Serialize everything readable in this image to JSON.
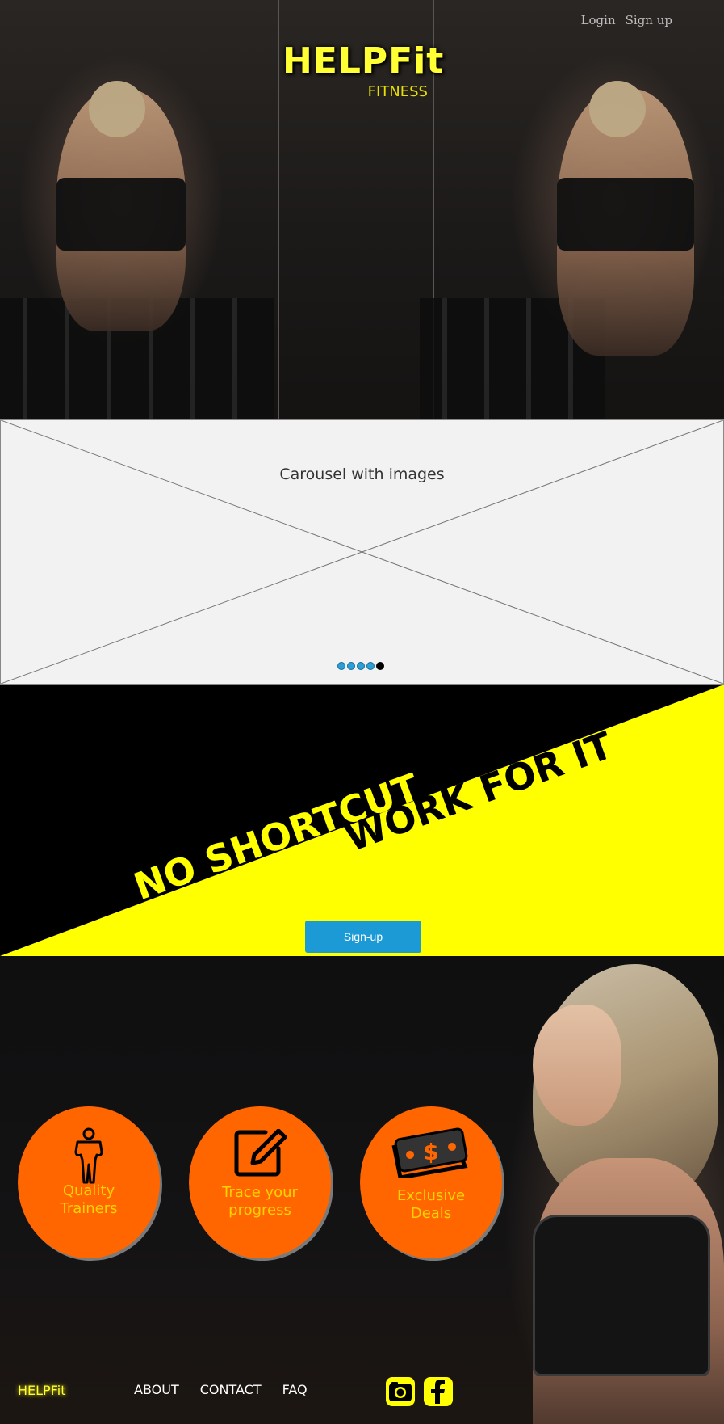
{
  "header": {
    "brand_name": "HELPFit",
    "brand_tagline": "FITNESS",
    "login_label": "Login",
    "signup_label": "Sign up"
  },
  "carousel": {
    "label": "Carousel with images",
    "dot_count": 5,
    "active_index": 4
  },
  "slogan": {
    "line1": "NO SHORTCUT",
    "line2": "WORK FOR IT",
    "signup_button": "Sign-up",
    "colors": {
      "dark": "#000000",
      "accent": "#ffff00",
      "button": "#1b9ad6"
    }
  },
  "features": [
    {
      "icon": "person-icon",
      "label_line1": "Quality",
      "label_line2": "Trainers"
    },
    {
      "icon": "edit-icon",
      "label_line1": "Trace your",
      "label_line2": "progress"
    },
    {
      "icon": "money-icon",
      "label_line1": "Exclusive",
      "label_line2": "Deals"
    }
  ],
  "footer": {
    "brand": "HELPFit",
    "nav": [
      "ABOUT",
      "CONTACT",
      "FAQ"
    ],
    "social": [
      "instagram-icon",
      "facebook-icon"
    ]
  },
  "theme": {
    "brand_yellow": "#ffff33",
    "feature_orange": "#ff6600",
    "feature_text": "#ffd200"
  }
}
